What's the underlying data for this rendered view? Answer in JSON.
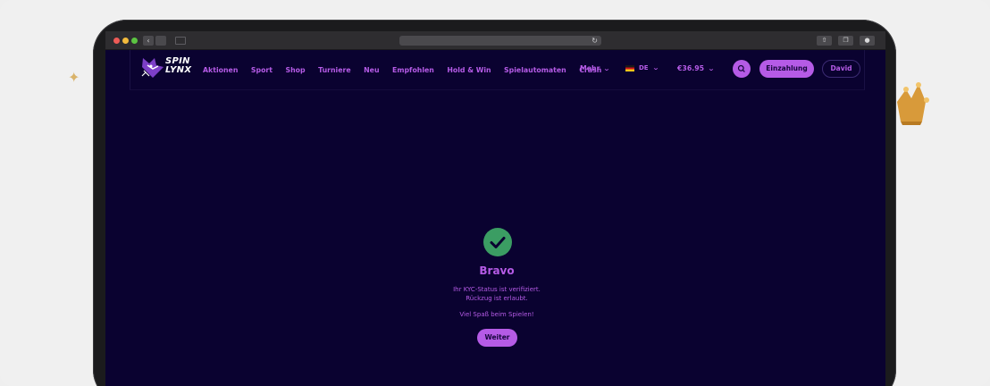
{
  "browser": {
    "traffic_lights": [
      "close",
      "minimize",
      "zoom"
    ],
    "back_icon": "chevron-left-icon",
    "forward_icon": "chevron-right-icon",
    "sidebar_icon": "sidebar-icon",
    "reload_icon": "reload-icon",
    "reload_glyph": "↻",
    "right_buttons": [
      "share-icon",
      "tabs-icon",
      "download-icon"
    ]
  },
  "brand": {
    "line1": "SPIN",
    "line2": "LYNX",
    "color": "#b55be6"
  },
  "nav": {
    "items": [
      "Aktionen",
      "Sport",
      "Shop",
      "Turniere",
      "Neu",
      "Empfohlen",
      "Hold & Win",
      "Spielautomaten",
      "Crash"
    ],
    "more_label": "Mehr",
    "language": "DE",
    "balance": "€36.95",
    "deposit_label": "Einzahlung",
    "user_label": "David"
  },
  "verification": {
    "status_icon": "checkmark-icon",
    "title": "Bravo",
    "line1": "Ihr KYC-Status ist verifiziert.",
    "line2": "Rückzug ist erlaubt.",
    "line3": "Viel Spaß beim Spielen!",
    "button_label": "Weiter"
  },
  "colors": {
    "background": "#0a0230",
    "accent": "#b55be6",
    "success": "#3b9d63"
  }
}
